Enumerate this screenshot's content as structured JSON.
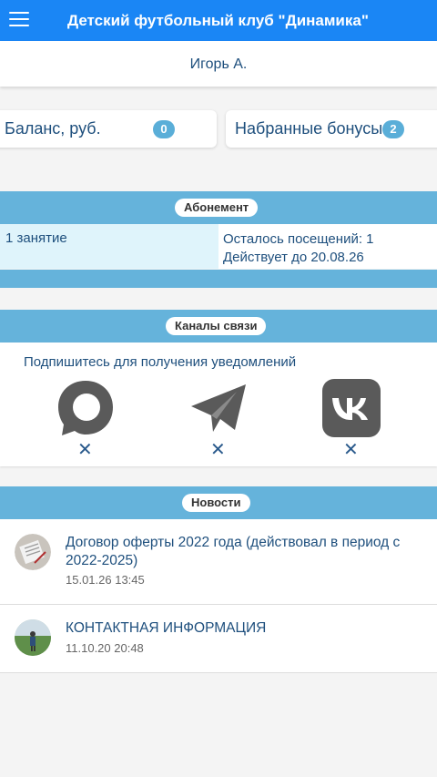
{
  "header": {
    "title": "Детский футбольный клуб \"Динамика\""
  },
  "user": {
    "name": "Игорь А."
  },
  "balance": {
    "label": "Баланс, руб.",
    "value": "0"
  },
  "bonuses": {
    "label": "Набранные бонусы",
    "value": "2"
  },
  "subscription": {
    "heading": "Абонемент",
    "name": "1 занятие",
    "remaining": "Осталось посещений: 1",
    "valid_until": "Действует до 20.08.26"
  },
  "channels": {
    "heading": "Каналы связи",
    "prompt": "Подпишитесь для получения уведомлений",
    "items": [
      {
        "icon": "max-messenger-icon",
        "status": "✕"
      },
      {
        "icon": "telegram-icon",
        "status": "✕"
      },
      {
        "icon": "vk-icon",
        "status": "✕"
      }
    ]
  },
  "news": {
    "heading": "Новости",
    "items": [
      {
        "title": "Договор оферты 2022 года (действовал в период с 2022-2025)",
        "date": "15.01.26 13:45"
      },
      {
        "title": "КОНТАКТНАЯ ИНФОРМАЦИЯ",
        "date": "11.10.20 20:48"
      }
    ]
  },
  "colors": {
    "topbar": "#1a86f5",
    "section": "#65b3db",
    "text": "#1e4f7d",
    "badge": "#5aaed8"
  }
}
